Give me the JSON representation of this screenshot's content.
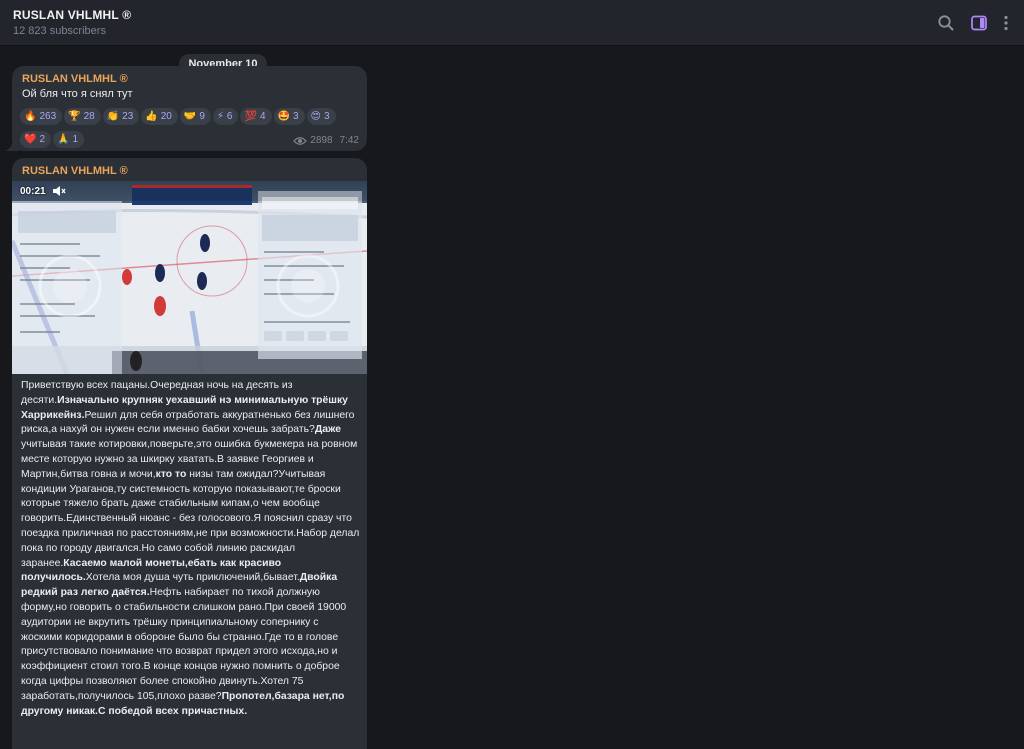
{
  "header": {
    "title": "RUSLAN VHLMHL ®",
    "subscribers": "12 823 subscribers",
    "icons": [
      "search-icon",
      "side-panel-icon",
      "more-icon"
    ]
  },
  "colors": {
    "author": "#e9a55a",
    "reaction_count": "#a7a9f5",
    "bubble": "#2b2f36",
    "accent_panel_icon": "#b388ff"
  },
  "date_separator": "November 10",
  "messages": [
    {
      "author": "RUSLAN VHLMHL ®",
      "text": "Ой бля что я снял тут",
      "reactions": [
        {
          "emoji": "🔥",
          "count": "263"
        },
        {
          "emoji": "🏆",
          "count": "28"
        },
        {
          "emoji": "👏",
          "count": "23"
        },
        {
          "emoji": "👍",
          "count": "20"
        },
        {
          "emoji": "🤝",
          "count": "9"
        },
        {
          "emoji": "⚡",
          "count": "6"
        },
        {
          "emoji": "💯",
          "count": "4"
        },
        {
          "emoji": "🤩",
          "count": "3"
        },
        {
          "emoji": "😍",
          "count": "3"
        },
        {
          "emoji": "❤️",
          "count": "2"
        },
        {
          "emoji": "🙏",
          "count": "1"
        }
      ],
      "views": "2898",
      "time": "7:42"
    },
    {
      "author": "RUSLAN VHLMHL ®",
      "video": {
        "elapsed": "00:21",
        "banner": "COLORADO'S PREMIER CAR CARE DESTINATION"
      },
      "paragraph_parts": [
        {
          "t": "Приветствую всех пацаны.Очередная ночь на десять из десяти.",
          "b": false
        },
        {
          "t": "Изначально крупняк уехавший нэ минимальную трёшку Харрикейнз.",
          "b": true
        },
        {
          "t": "Решил для себя отработать аккуратненько без лишнего риска,а нахуй он нужен если именно бабки хочешь забрать?",
          "b": false
        },
        {
          "t": "Даже",
          "b": true
        },
        {
          "t": " учитывая такие котировки,поверьте,это ошибка букмекера на ровном месте которую нужно за шкирку хватать.",
          "b": false
        },
        {
          "t": "В заявке Георгиев и Мартин,битва говна и мочи,",
          "b": false
        },
        {
          "t": "кто то",
          "b": true
        },
        {
          "t": " низы там ожидал?",
          "b": false
        },
        {
          "t": "Учитывая кондиции Ураганов,ту системность которую показывают,те броски которые тяжело брать даже стабильным кипам,о чем вообще говорить.Единственный нюанс - без голосового.Я пояснил сразу что поездка приличная по расстояниям,не при возможности.Набор делал пока по городу двигался.Но само собой линию раскидал заранее.",
          "b": false
        },
        {
          "t": "Касаемо малой монеты,ебать как красиво получилось.",
          "b": true
        },
        {
          "t": "Хотела моя душа чуть приключений,бывает.",
          "b": false
        },
        {
          "t": "Двойка редкий раз легко даётся.",
          "b": true
        },
        {
          "t": "Нефть набирает по тихой должную форму,но говорить о стабильности слишком рано.При своей 19000 аудитории не вкрутить трёшку принципиальному сопернику с жоскими коридорами в обороне было бы странно.Где то в голове присутствовало понимание что возврат придел этого исхода,но и коэффициент стоил того.В конце концов нужно помнить о доброе когда цифры позволяют более спокойно двинуть.Хотел 75 заработать,получилось 105,плохо разве?",
          "b": false
        },
        {
          "t": "Пропотел,базара нет,по другому никак.",
          "b": true
        },
        {
          "t": "С победой всех причастных.",
          "b": true
        }
      ]
    }
  ]
}
